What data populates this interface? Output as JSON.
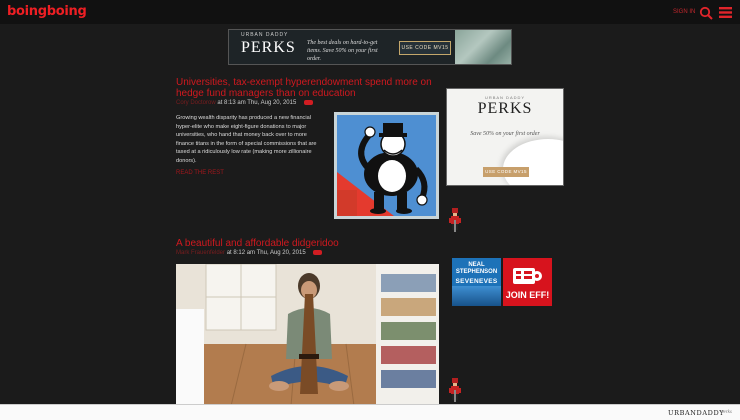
{
  "header": {
    "logo": "boingboing",
    "signin": "SIGN IN",
    "brand_color": "#ee1f24"
  },
  "banner_ad": {
    "brand": "URBAN DADDY",
    "title": "PERKS",
    "tagline": "The best deals on hard-to-get items. Save 50% on your first order.",
    "button": "USE CODE MV15"
  },
  "posts": [
    {
      "title": "Universities, tax-exempt hyperendowment spend more on hedge fund managers than on education",
      "author": "Cory Doctorow",
      "time": "at 8:13 am Thu, Aug 20, 2015",
      "excerpt": "Growing wealth disparity has produced a new financial hyper-elite who make eight-figure donations to major universities, who hand that money back over to more finance titans in the form of special commissions that are taxed at a ridiculously low rate (making more zillionaire donors).",
      "read_more": "READ THE REST"
    },
    {
      "title": "A beautiful and affordable didgeridoo",
      "author": "Mark Frauenfelder",
      "time": "at 8:12 am Thu, Aug 20, 2015"
    }
  ],
  "sidebar_ad": {
    "brand": "URBAN DADDY",
    "title": "PERKS",
    "tagline": "Save 50% on your first order",
    "button": "USE CODE MV15"
  },
  "book_ad": {
    "author": "NEAL STEPHENSON",
    "title": "SEVENEVES"
  },
  "eff_ad": {
    "label": "JOIN EFF!"
  },
  "footer": {
    "brand": "URBANDADDY",
    "sub": "perks"
  }
}
